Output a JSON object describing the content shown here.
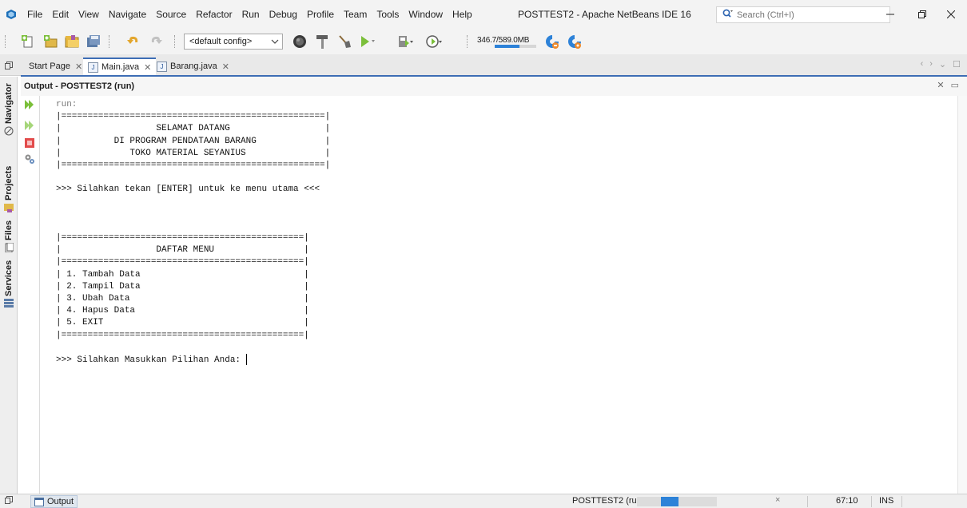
{
  "window": {
    "title": "POSTTEST2 - Apache NetBeans IDE 16",
    "search_placeholder": "Search (Ctrl+I)"
  },
  "menus": [
    "File",
    "Edit",
    "View",
    "Navigate",
    "Source",
    "Refactor",
    "Run",
    "Debug",
    "Profile",
    "Team",
    "Tools",
    "Window",
    "Help"
  ],
  "toolbar": {
    "config_value": "<default config>",
    "memory_text": "346.7/589.0MB",
    "memory_fraction": 0.59
  },
  "tabs": [
    {
      "label": "Start Page",
      "active": false
    },
    {
      "label": "Main.java",
      "active": true
    },
    {
      "label": "Barang.java",
      "active": false
    }
  ],
  "sidebar": {
    "tabs": [
      "Navigator",
      "Projects",
      "Files",
      "Services"
    ]
  },
  "output": {
    "title": "Output - POSTTEST2 (run)",
    "lines": [
      "run:",
      "|==================================================|",
      "|                  SELAMAT DATANG                  |",
      "|          DI PROGRAM PENDATAAN BARANG             |",
      "|             TOKO MATERIAL SEYANIUS               |",
      "|==================================================|",
      "",
      ">>> Silahkan tekan [ENTER] untuk ke menu utama <<<",
      "",
      "",
      "",
      "|==============================================|",
      "|                  DAFTAR MENU                 |",
      "|==============================================|",
      "| 1. Tambah Data                               |",
      "| 2. Tampil Data                               |",
      "| 3. Ubah Data                                 |",
      "| 4. Hapus Data                                |",
      "| 5. EXIT                                      |",
      "|==============================================|",
      "",
      ">>> Silahkan Masukkan Pilihan Anda: "
    ]
  },
  "status": {
    "output_tab": "Output",
    "run_label": "POSTTEST2 (run)",
    "cancel": "×",
    "position": "67:10",
    "mode": "INS"
  }
}
